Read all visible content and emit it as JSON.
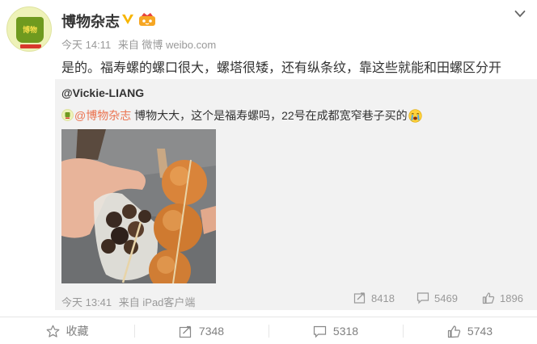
{
  "header": {
    "user_name": "博物杂志",
    "avatar_text": "博物",
    "time": "今天 14:11",
    "source": "来自 微博 weibo.com",
    "icons": [
      "verified-icon",
      "vip-icon",
      "chevron-down-icon"
    ]
  },
  "post": {
    "text": "是的。福寿螺的螺口很大，螺塔很矮，还有纵条纹，靠这些就能和田螺区分开"
  },
  "repost": {
    "author": "@Vickie-LIANG",
    "mention": "@博物杂志",
    "text": " 博物大大，这个是福寿螺吗，22号在成都宽窄巷子买的",
    "time": "今天 13:41",
    "source": "来自 iPad客户端",
    "stats": {
      "reposts": "8418",
      "comments": "5469",
      "likes": "1896"
    }
  },
  "actions": {
    "favorite_label": "收藏",
    "repost_count": "7348",
    "comment_count": "5318",
    "like_count": "5743"
  },
  "colors": {
    "mention": "#eb7350",
    "meta_text": "#999999",
    "repost_background": "#f2f2f2",
    "verified_badge": "#f7b500"
  }
}
